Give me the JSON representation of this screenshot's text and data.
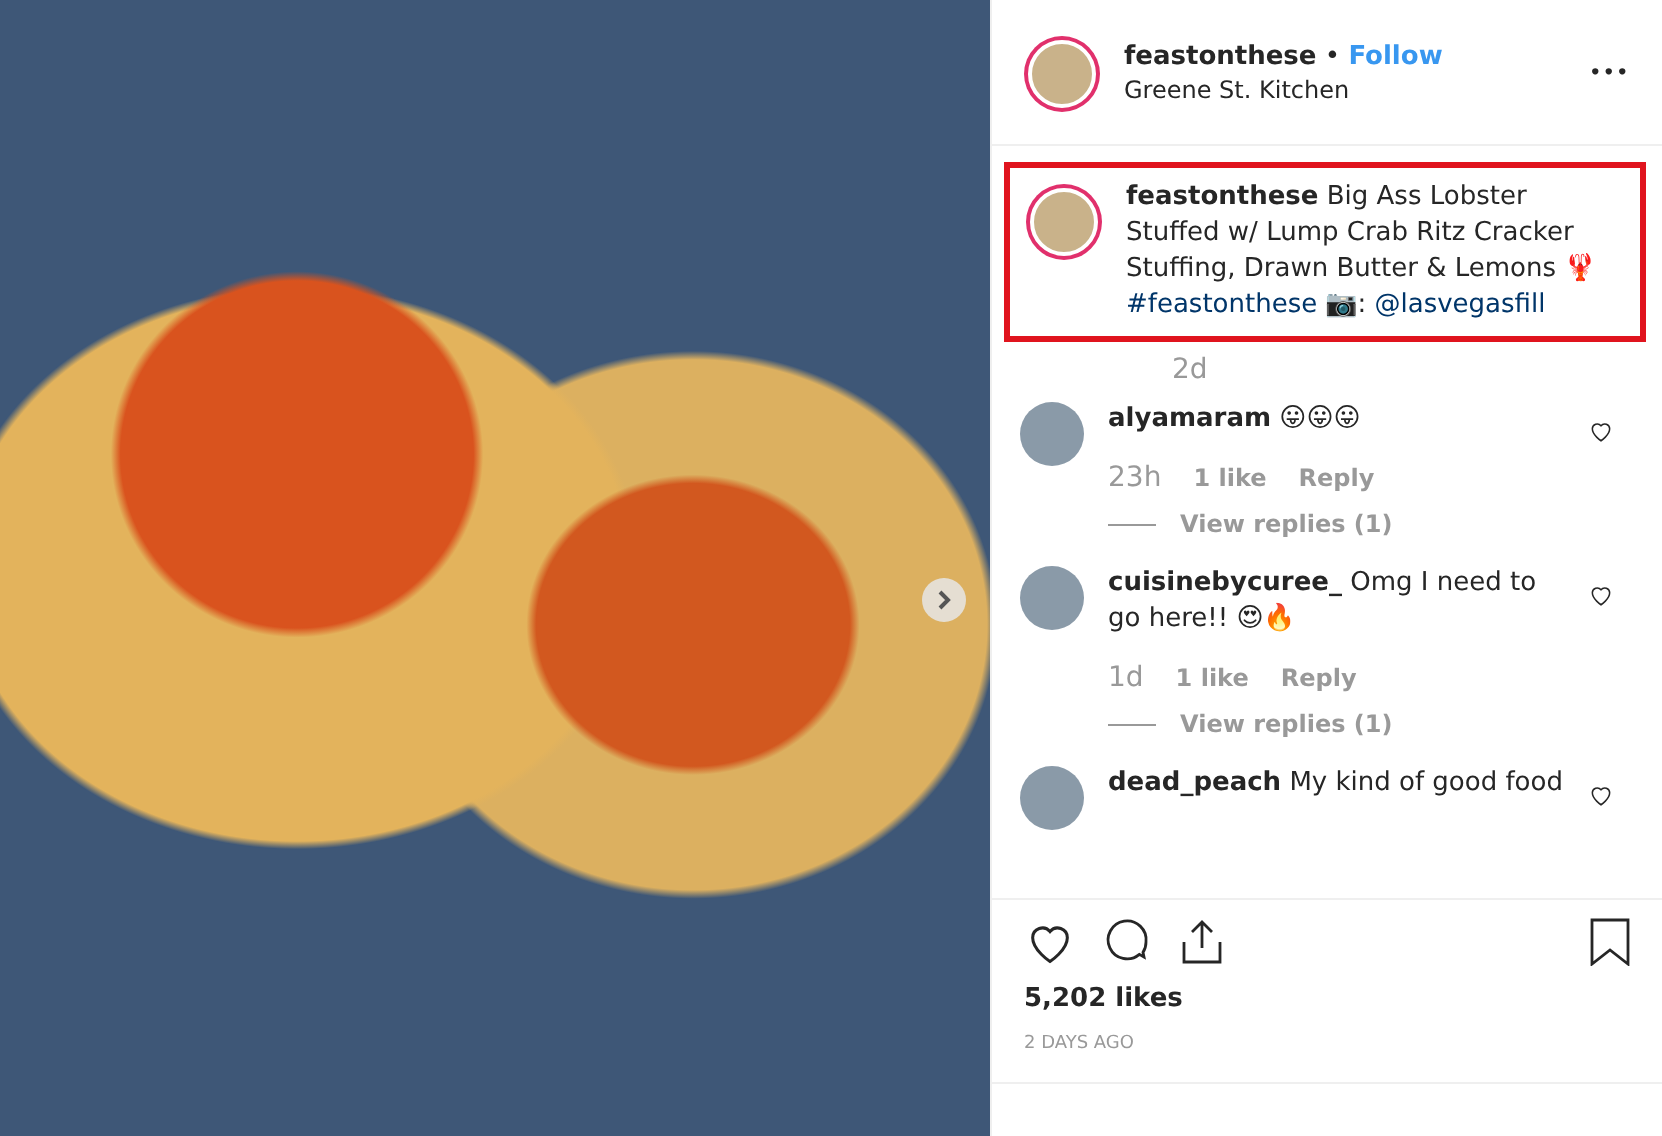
{
  "photo": {
    "has_next": true
  },
  "header": {
    "username": "feastonthese",
    "separator": "•",
    "follow": "Follow",
    "location": "Greene St. Kitchen",
    "more": "•••"
  },
  "caption": {
    "highlighted": true,
    "username": "feastonthese",
    "text": "Big Ass Lobster Stuffed w/ Lump Crab Ritz Cracker Stuffing, Drawn Butter & Lemons 🦞",
    "hashtag": "#feastonthese",
    "credit_icon": "📷",
    "credit_sep": ":",
    "mention": "@lasvegasfill",
    "time": "2d"
  },
  "comments": [
    {
      "username": "alyamaram",
      "text": "😛😛😛",
      "time": "23h",
      "likes": "1 like",
      "reply": "Reply",
      "view_replies": "View replies (1)",
      "liked": false
    },
    {
      "username": "cuisinebycuree_",
      "text": "Omg I need to go here!! 😍🔥",
      "time": "1d",
      "likes": "1 like",
      "reply": "Reply",
      "view_replies": "View replies (1)",
      "liked": false
    },
    {
      "username": "dead_peach",
      "text": "My kind of good food",
      "liked": false
    }
  ],
  "actions": {
    "liked": false,
    "saved": false
  },
  "likes": "5,202 likes",
  "date": "2 DAYS AGO"
}
